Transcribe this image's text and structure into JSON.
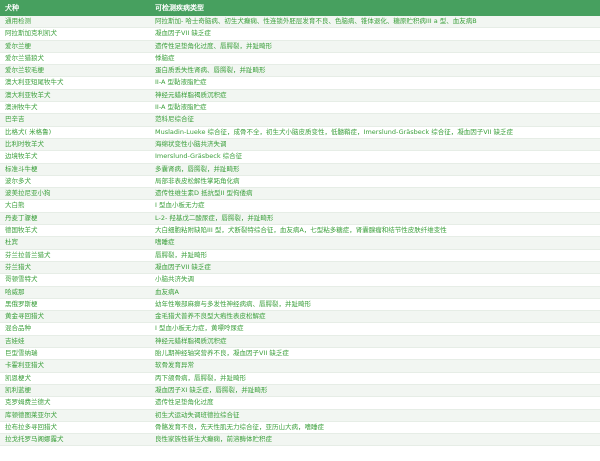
{
  "header": {
    "breed": "犬种",
    "diseases": "可检测疾病类型"
  },
  "rows": [
    [
      "通用检测",
      "阿拉斯加- 哈士奇脑病、初生犬癫痫、性连锁外胚层发育不良、色脑病、锥体退化、糖原贮积病III a 型、血友病B"
    ],
    [
      "阿拉斯加克利凯犬",
      "凝血因子VII 缺乏症"
    ],
    [
      "爱尔兰梗",
      "遗传性足垫角化过度、唇腭裂，并趾畸形"
    ],
    [
      "爱尔兰猎狼犬",
      "悸脑症"
    ],
    [
      "爱尔兰软毛梗",
      "蛋白质丢失性肾病、唇腭裂，并趾畸形"
    ],
    [
      "澳大利亚短尾牧牛犬",
      "II-A 型黏液脂贮症"
    ],
    [
      "澳大利亚牧羊犬",
      "神经元蜡样脂褐质沉积症"
    ],
    [
      "澳洲牧牛犬",
      "II-A 型黏液脂贮症"
    ],
    [
      "巴辛吉",
      "范科尼综合征"
    ],
    [
      "比格犬( 米格鲁)",
      "Musladin-Lueke 综合征，成骨不全，初生犬小脑皮质变性，低髓鞘症，Imerslund-Gräsbeck 综合征，凝血因子VII 缺乏症"
    ],
    [
      "比利时牧羊犬",
      "海绵状变性小脑共济失调"
    ],
    [
      "边境牧羊犬",
      "Imerslund-Gräsbeck 综合征"
    ],
    [
      "标准斗牛梗",
      "多囊肾病，唇腭裂，并趾畸形"
    ],
    [
      "波尔多犬",
      "局部非表皮松解性掌跖角化病"
    ],
    [
      "波美拉尼亚小狗",
      "遗传性维生素D 抵抗型II 型佝偻病"
    ],
    [
      "大白熊",
      "I 型血小板无力症"
    ],
    [
      "丹麦丁骤梗",
      "L-2- 羟基戊二酸尿症，唇腭裂，并趾畸形"
    ],
    [
      "德国牧羊犬",
      "大白细胞粘附缺陷III 型，犬断裂特综合征，血友病A，七型粘多糖症，肾囊腺瘤和结节性皮肤纤维变性"
    ],
    [
      "杜宾",
      "嗜睡症"
    ],
    [
      "芬兰拉普兰猎犬",
      "唇腭裂，并趾畸形"
    ],
    [
      "芬兰猎犬",
      "凝血因子VII 缺乏症"
    ],
    [
      "哥顿雪特犬",
      "小脑共济失调"
    ],
    [
      "哈威那",
      "血友病A"
    ],
    [
      "黑俄罗斯梗",
      "幼年性喉部麻痹与多发性神经病病、唇腭裂，并趾畸形"
    ],
    [
      "黄金寻回猎犬",
      "金毛猎犬普养不良型大疱性表皮松解症"
    ],
    [
      "混合品种",
      "I 型血小板无力症，黄嘌呤尿症"
    ],
    [
      "吉娃娃",
      "神经元蜡样脂褐质沉积症"
    ],
    [
      "巨型雪纳瑞",
      "胎儿期神经轴突营养不良，凝血因子VII 缺乏症"
    ],
    [
      "卡霍利亚猎犬",
      "软骨发育异常"
    ],
    [
      "凯恩梗犬",
      "丙下颌骨病，唇腭裂，并趾畸形"
    ],
    [
      "凯利蓝梗",
      "凝血因子XI 缺乏症，唇腭裂，并趾畸形"
    ],
    [
      "克罗姆费兰德犬",
      "遗传性足垫角化过度"
    ],
    [
      "库顿德图莱亚尔犬",
      "初生犬运动失调班德拉综合征"
    ],
    [
      "拉布拉多寻回猎犬",
      "骨骼发育不良，先天性肌无力综合征，亚历山大病，嗜睡症"
    ],
    [
      "拉戈托罗马阁娜露犬",
      "良性家族性新生犬癫痫，前溶酶体贮积症"
    ]
  ]
}
